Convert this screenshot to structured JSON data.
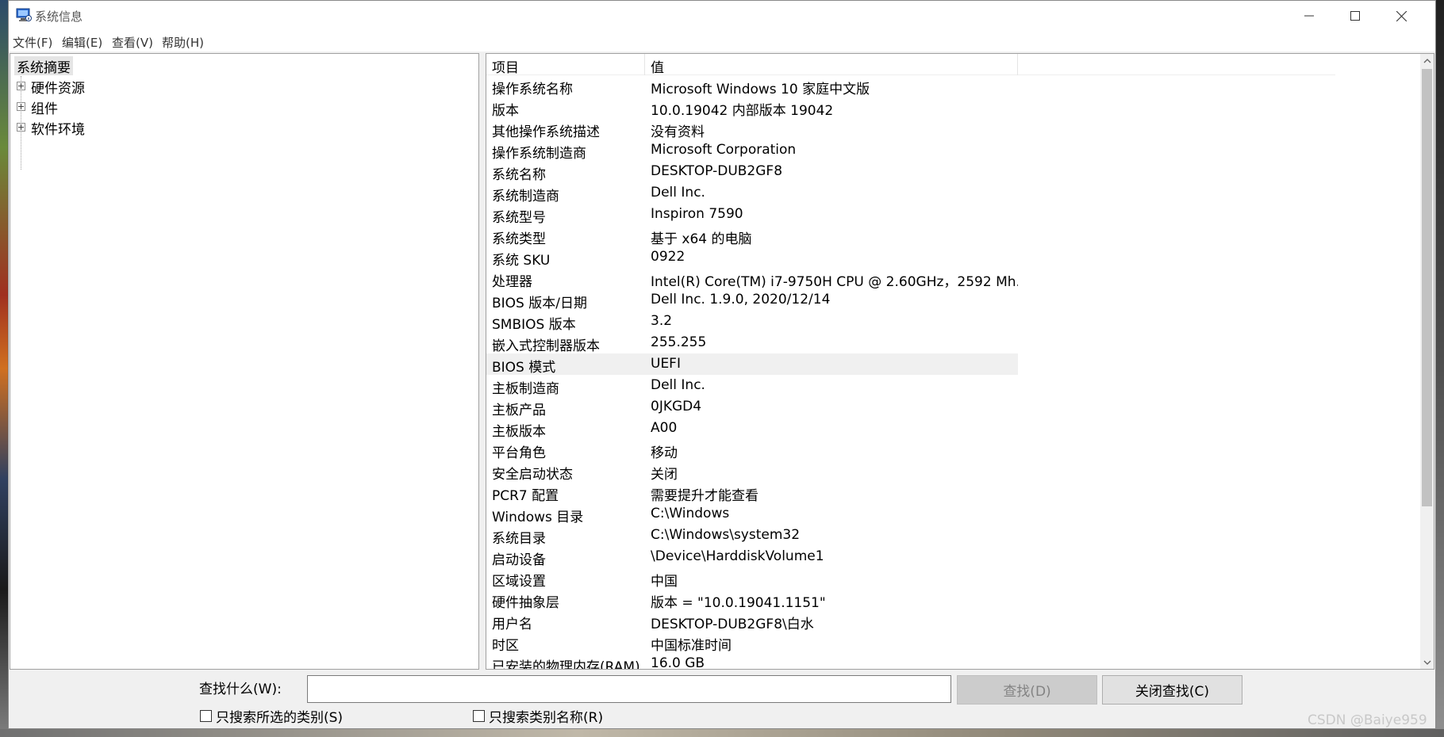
{
  "window": {
    "title": "系统信息",
    "controls": {
      "minimize": "minimize-icon",
      "maximize": "maximize-icon",
      "close": "close-icon"
    }
  },
  "menu": [
    {
      "label": "文件(F)"
    },
    {
      "label": "编辑(E)"
    },
    {
      "label": "查看(V)"
    },
    {
      "label": "帮助(H)"
    }
  ],
  "tree": {
    "root": "系统摘要",
    "children": [
      {
        "label": "硬件资源"
      },
      {
        "label": "组件"
      },
      {
        "label": "软件环境"
      }
    ]
  },
  "details": {
    "columns": {
      "key": "项目",
      "value": "值"
    },
    "selected_index": 13,
    "rows": [
      {
        "key": "操作系统名称",
        "value": "Microsoft Windows 10 家庭中文版"
      },
      {
        "key": "版本",
        "value": "10.0.19042 内部版本 19042"
      },
      {
        "key": "其他操作系统描述",
        "value": "没有资料"
      },
      {
        "key": "操作系统制造商",
        "value": "Microsoft Corporation"
      },
      {
        "key": "系统名称",
        "value": "DESKTOP-DUB2GF8"
      },
      {
        "key": "系统制造商",
        "value": "Dell Inc."
      },
      {
        "key": "系统型号",
        "value": "Inspiron 7590"
      },
      {
        "key": "系统类型",
        "value": "基于 x64 的电脑"
      },
      {
        "key": "系统 SKU",
        "value": "0922"
      },
      {
        "key": "处理器",
        "value": "Intel(R) Core(TM) i7-9750H CPU @ 2.60GHz，2592 Mh..."
      },
      {
        "key": "BIOS 版本/日期",
        "value": "Dell Inc. 1.9.0, 2020/12/14"
      },
      {
        "key": "SMBIOS 版本",
        "value": "3.2"
      },
      {
        "key": "嵌入式控制器版本",
        "value": "255.255"
      },
      {
        "key": "BIOS 模式",
        "value": "UEFI"
      },
      {
        "key": "主板制造商",
        "value": "Dell Inc."
      },
      {
        "key": "主板产品",
        "value": "0JKGD4"
      },
      {
        "key": "主板版本",
        "value": "A00"
      },
      {
        "key": "平台角色",
        "value": "移动"
      },
      {
        "key": "安全启动状态",
        "value": "关闭"
      },
      {
        "key": "PCR7 配置",
        "value": "需要提升才能查看"
      },
      {
        "key": "Windows 目录",
        "value": "C:\\Windows"
      },
      {
        "key": "系统目录",
        "value": "C:\\Windows\\system32"
      },
      {
        "key": "启动设备",
        "value": "\\Device\\HarddiskVolume1"
      },
      {
        "key": "区域设置",
        "value": "中国"
      },
      {
        "key": "硬件抽象层",
        "value": "版本 = \"10.0.19041.1151\""
      },
      {
        "key": "用户名",
        "value": "DESKTOP-DUB2GF8\\白水"
      },
      {
        "key": "时区",
        "value": "中国标准时间"
      },
      {
        "key": "已安装的物理内存(RAM)",
        "value": "16.0 GB"
      }
    ]
  },
  "find": {
    "label": "查找什么(W):",
    "input_value": "",
    "find_button": "查找(D)",
    "close_button": "关闭查找(C)",
    "checkbox_selected_category": "只搜索所选的类别(S)",
    "checkbox_category_names": "只搜索类别名称(R)"
  },
  "watermark": "CSDN @Baiye959"
}
